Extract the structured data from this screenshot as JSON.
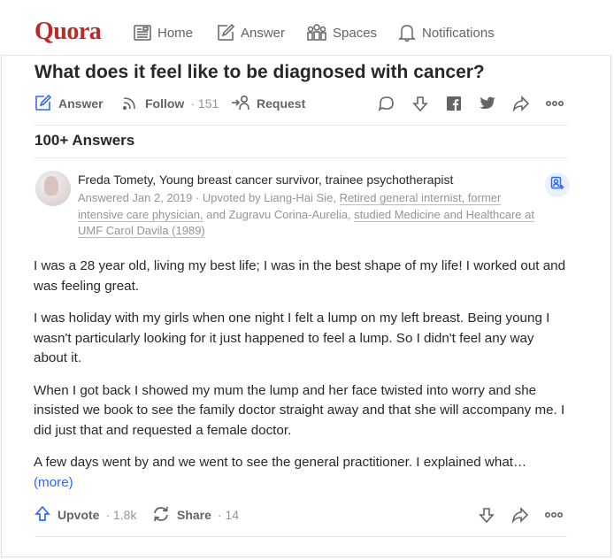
{
  "nav": {
    "logo": "Quora",
    "items": [
      {
        "label": "Home",
        "icon": "home-icon"
      },
      {
        "label": "Answer",
        "icon": "answer-icon"
      },
      {
        "label": "Spaces",
        "icon": "spaces-icon"
      },
      {
        "label": "Notifications",
        "icon": "bell-icon"
      }
    ]
  },
  "question": {
    "title": "What does it feel like to be diagnosed with cancer?",
    "answer_label": "Answer",
    "follow_label": "Follow",
    "follow_count": "· 151",
    "request_label": "Request"
  },
  "answers_count": "100+ Answers",
  "answer": {
    "author": "Freda Tomety, Young breast cancer survivor, trainee psychotherapist",
    "meta_prefix": "Answered Jan 2, 2019 · Upvoted by Liang-Hai Sie, ",
    "meta_link1": "Retired general internist, former intensive care physician,",
    "meta_mid": " and Zugravu Corina-Aurelia, ",
    "meta_link2": "studied Medicine and Healthcare at UMF Carol Davila (1989)",
    "paragraphs": [
      "I was a 28 year old, living my best life; I was in the best shape of my life! I worked out and was feeling great.",
      "I was holiday with my girls when one night I felt a lump on my left breast. Being young I wasn't particularly looking for it just happened to feel a lump. So I didn't feel any way about it.",
      "When I got back I showed my mum the lump and her face twisted into worry and she insisted we book to see the family doctor straight away and that she will accompany me. I did just that and requested a female doctor.",
      "A few days went by and we went to see the general practitioner. I explained what…"
    ],
    "more_label": "(more)",
    "upvote_label": "Upvote",
    "upvote_count": "· 1.8k",
    "share_label": "Share",
    "share_count": "· 14"
  },
  "colors": {
    "brand": "#b92b27",
    "link": "#2e69ff",
    "muted": "#939598",
    "text": "#282829"
  }
}
